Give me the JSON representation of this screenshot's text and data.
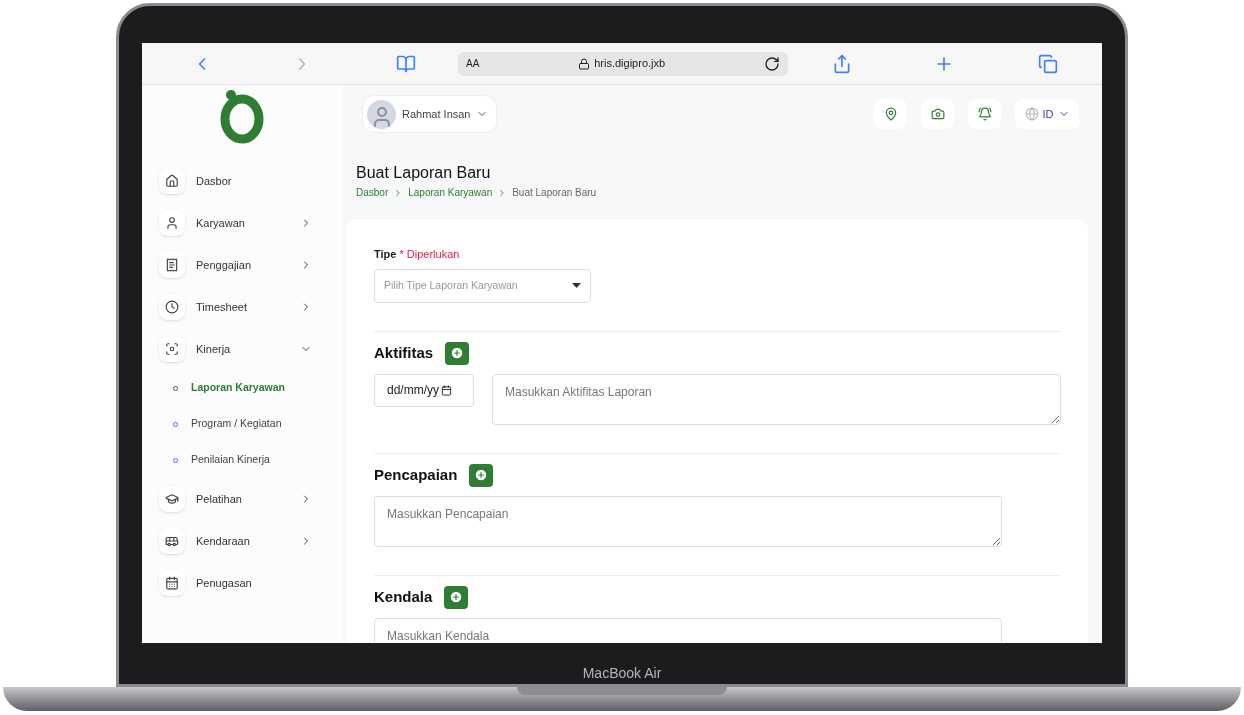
{
  "browser": {
    "text_size": "AA",
    "url": "hris.digipro.jxb"
  },
  "device": {
    "label": "MacBook Air"
  },
  "sidebar": {
    "items": [
      {
        "label": "Dasbor",
        "kind": "link"
      },
      {
        "label": "Karyawan",
        "kind": "group",
        "expanded": false
      },
      {
        "label": "Penggajian",
        "kind": "group",
        "expanded": false
      },
      {
        "label": "Timesheet",
        "kind": "group",
        "expanded": false
      },
      {
        "label": "Kinerja",
        "kind": "group",
        "expanded": true,
        "children": [
          {
            "label": "Laporan Karyawan",
            "selected": true
          },
          {
            "label": "Program / Kegiatan",
            "selected": false
          },
          {
            "label": "Penilaian Kinerja",
            "selected": false
          }
        ]
      },
      {
        "label": "Pelatihan",
        "kind": "group",
        "expanded": false
      },
      {
        "label": "Kendaraan",
        "kind": "group",
        "expanded": false
      },
      {
        "label": "Penugasan",
        "kind": "link"
      }
    ]
  },
  "header": {
    "user": "Rahmat Insan",
    "language": "ID"
  },
  "page": {
    "title": "Buat Laporan Baru",
    "breadcrumb": [
      {
        "label": "Dasbor",
        "current": false
      },
      {
        "label": "Laporan Karyawan",
        "current": false
      },
      {
        "label": "Buat Laporan Baru",
        "current": true
      }
    ]
  },
  "form": {
    "type_field": {
      "label": "Tipe",
      "required": "* Diperlukan",
      "placeholder": "Pilih Tipe Laporan Karyawan"
    },
    "sections": [
      {
        "title": "Aktifitas",
        "kind": "dated",
        "date_placeholder": "dd/mm/yy",
        "placeholder": "Masukkan Aktifitas Laporan"
      },
      {
        "title": "Pencapaian",
        "kind": "text",
        "placeholder": "Masukkan Pencapaian"
      },
      {
        "title": "Kendala",
        "kind": "text",
        "placeholder": "Masukkan Kendala"
      }
    ]
  }
}
